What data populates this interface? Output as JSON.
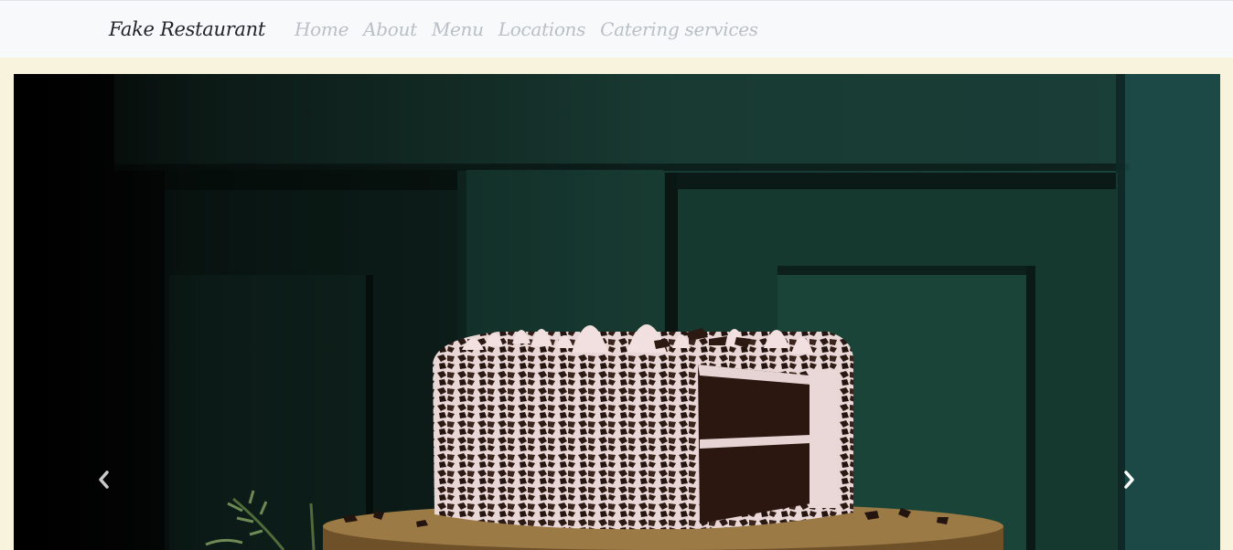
{
  "navbar": {
    "brand": "Fake Restaurant",
    "links": [
      "Home",
      "About",
      "Menu",
      "Locations",
      "Catering services"
    ]
  },
  "carousel": {
    "slide_image": "chocolate-cake-photo",
    "prev_icon": "chevron-left-icon",
    "next_icon": "chevron-right-icon"
  },
  "colors": {
    "page_background": "#f7f3dc",
    "navbar_background": "#f8f9fa",
    "nav_link": "#b8bfc6",
    "brand_text": "#212529"
  }
}
